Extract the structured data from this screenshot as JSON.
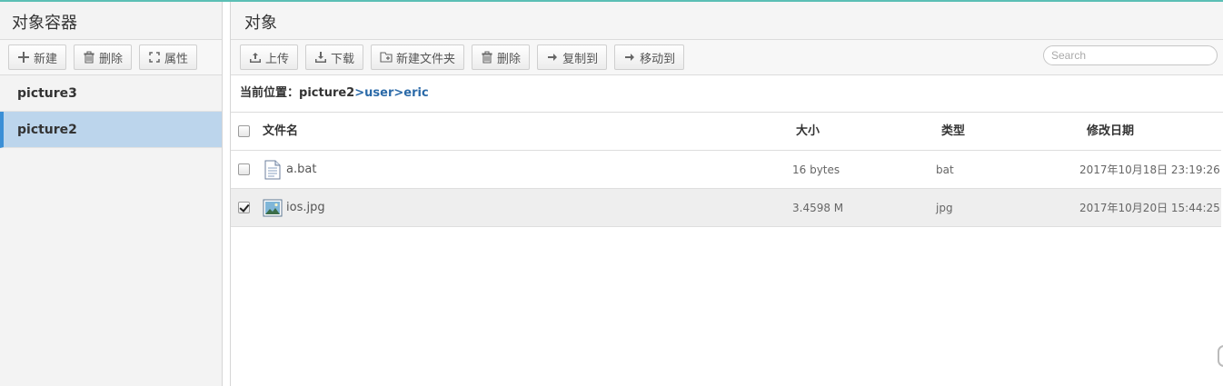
{
  "left": {
    "title": "对象容器",
    "toolbar": {
      "new_label": "新建",
      "delete_label": "删除",
      "props_label": "属性"
    },
    "containers": [
      {
        "label": "picture3",
        "active": false
      },
      {
        "label": "picture2",
        "active": true
      }
    ]
  },
  "right": {
    "title": "对象",
    "toolbar": {
      "upload_label": "上传",
      "download_label": "下载",
      "new_folder_label": "新建文件夹",
      "delete_label": "删除",
      "copy_label": "复制到",
      "move_label": "移动到"
    },
    "search": {
      "placeholder": "Search",
      "value": ""
    },
    "breadcrumb": {
      "label": "当前位置：",
      "root": "picture2",
      "sep": ">",
      "path": [
        "user",
        "eric"
      ]
    },
    "table": {
      "headers": {
        "name": "文件名",
        "size": "大小",
        "type": "类型",
        "date": "修改日期"
      },
      "rows": [
        {
          "name": "a.bat",
          "size": "16 bytes",
          "type": "bat",
          "date": "2017年10月18日 23:19:26",
          "checked": false,
          "icon": "text-file-icon"
        },
        {
          "name": "ios.jpg",
          "size": "3.4598 M",
          "type": "jpg",
          "date": "2017年10月20日 15:44:25",
          "checked": true,
          "icon": "image-file-icon"
        }
      ]
    }
  },
  "colors": {
    "accent": "#5bbfb5",
    "active_item": "#bcd5ec",
    "active_border": "#3b8fd6",
    "link": "#2b6aa8"
  }
}
